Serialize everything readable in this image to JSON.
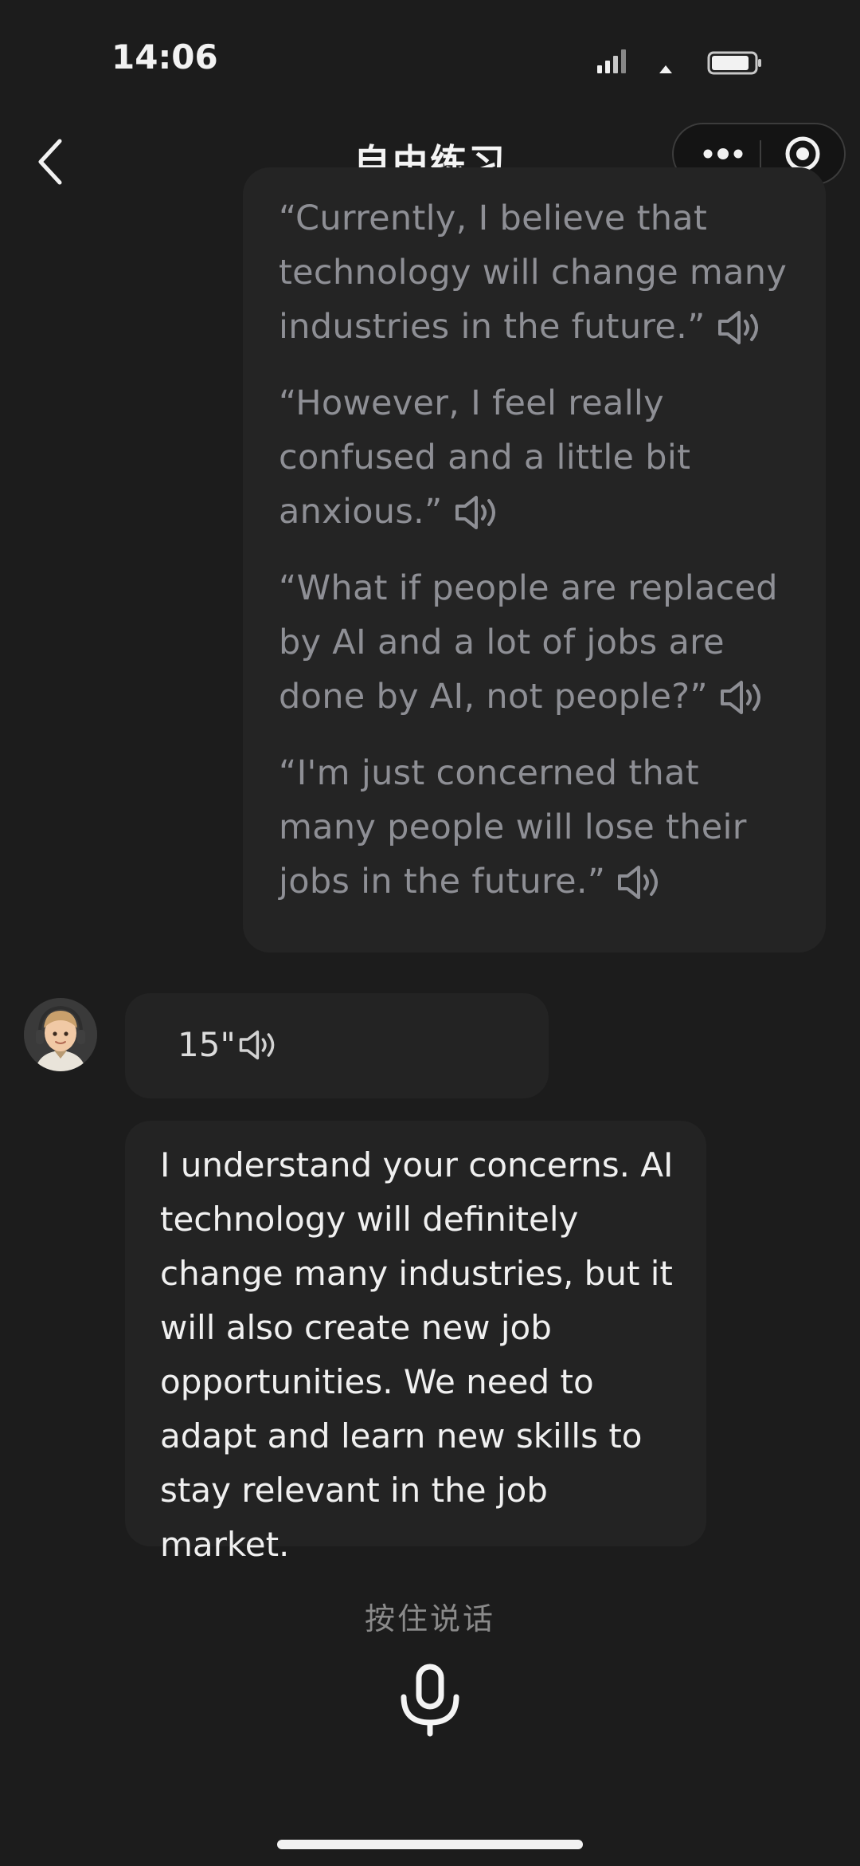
{
  "status_bar": {
    "time": "14:06"
  },
  "nav": {
    "title": "自由练习"
  },
  "user_message": {
    "sentences": [
      {
        "text": "“Currently, I believe that technology will change many industries in the future.”"
      },
      {
        "text": "“However, I feel really confused and a little bit anxious.”"
      },
      {
        "text": "“What if people are replaced by AI and a lot of jobs are done by AI, not people?”"
      },
      {
        "text": "“I'm just concerned that many people will lose their jobs in the future.”"
      }
    ]
  },
  "ai_message": {
    "voice_duration": "15\"",
    "text": "I understand your concerns. AI technology will definitely change many industries, but it will also create new job opportunities. We need to adapt and learn new skills to stay relevant in the job market."
  },
  "input": {
    "hold_to_talk_label": "按住说话"
  },
  "colors": {
    "background": "#1c1c1c",
    "bubble": "#242424",
    "user_text": "#8e8f95",
    "ai_text": "#f0f0f0"
  },
  "icons": [
    "back-arrow-icon",
    "more-icon",
    "close-target-icon",
    "speaker-icon",
    "microphone-icon"
  ]
}
